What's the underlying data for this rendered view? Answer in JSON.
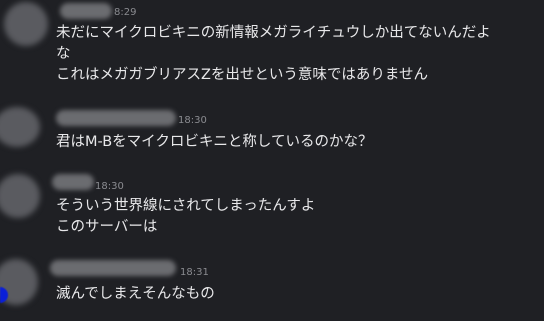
{
  "messages": [
    {
      "timestamp": "8:29",
      "lines": [
        "未だにマイクロビキニの新情報メガライチュウしか出てないんだよ",
        "な",
        "これはメガガブリアスZを出せという意味ではありません"
      ]
    },
    {
      "timestamp": "18:30",
      "lines": [
        "君はM-Bをマイクロビキニと称しているのかな？"
      ]
    },
    {
      "timestamp": "18:30",
      "lines": [
        "そういう世界線にされてしまったんすよ",
        "このサーバーは"
      ]
    },
    {
      "timestamp": "18:31",
      "lines": [
        "滅んでしまえそんなもの"
      ]
    }
  ],
  "colors": {
    "background": "#1f2024",
    "text": "#e8e8ea",
    "timestamp": "#8a8b90",
    "status_indicator": "#0a1fd8"
  }
}
